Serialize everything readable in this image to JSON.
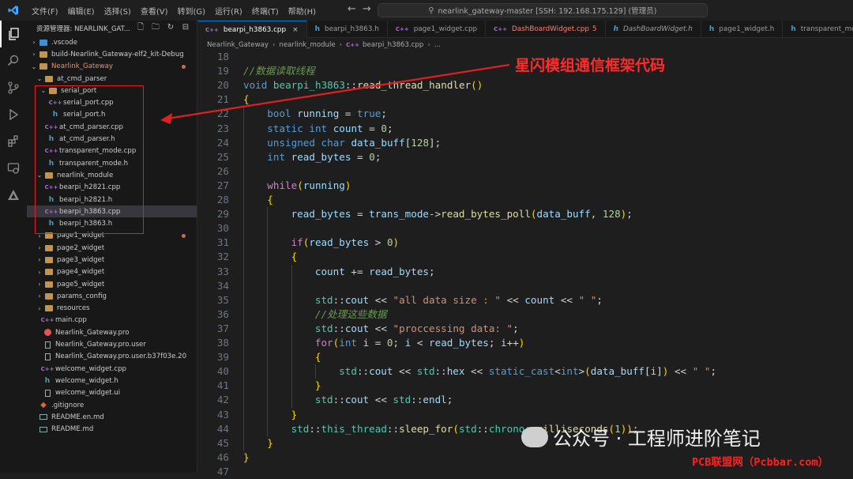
{
  "titlebar": {
    "menu": [
      "文件(F)",
      "编辑(E)",
      "选择(S)",
      "查看(V)",
      "转到(G)",
      "运行(R)",
      "终端(T)",
      "帮助(H)"
    ],
    "search": "nearlink_gateway-master [SSH: 192.168.175.129] (管理员)"
  },
  "sidebar": {
    "title": "资源管理器: NEARLINK_GAT...",
    "tree": [
      {
        "label": ".vscode",
        "depth": 1,
        "kind": "folder-blue",
        "chev": "›"
      },
      {
        "label": "build-Nearlink_Gateway-elf2_kit-Debug",
        "depth": 1,
        "kind": "folder",
        "chev": "›"
      },
      {
        "label": "Nearlink_Gateway",
        "depth": 1,
        "kind": "folder",
        "chev": "⌄",
        "accent": true,
        "dot": true
      },
      {
        "label": "at_cmd_parser",
        "depth": 2,
        "kind": "folder",
        "chev": "⌄"
      },
      {
        "label": "serial_port",
        "depth": 3,
        "kind": "folder",
        "chev": "⌄"
      },
      {
        "label": "serial_port.cpp",
        "depth": 4,
        "kind": "cpp"
      },
      {
        "label": "serial_port.h",
        "depth": 4,
        "kind": "h"
      },
      {
        "label": "at_cmd_parser.cpp",
        "depth": 3,
        "kind": "cpp"
      },
      {
        "label": "at_cmd_parser.h",
        "depth": 3,
        "kind": "h"
      },
      {
        "label": "transparent_mode.cpp",
        "depth": 3,
        "kind": "cpp"
      },
      {
        "label": "transparent_mode.h",
        "depth": 3,
        "kind": "h"
      },
      {
        "label": "nearlink_module",
        "depth": 2,
        "kind": "folder",
        "chev": "⌄"
      },
      {
        "label": "bearpi_h2821.cpp",
        "depth": 3,
        "kind": "cpp"
      },
      {
        "label": "bearpi_h2821.h",
        "depth": 3,
        "kind": "h"
      },
      {
        "label": "bearpi_h3863.cpp",
        "depth": 3,
        "kind": "cpp",
        "selected": true
      },
      {
        "label": "bearpi_h3863.h",
        "depth": 3,
        "kind": "h"
      },
      {
        "label": "page1_widget",
        "depth": 2,
        "kind": "folder",
        "chev": "›",
        "dot": true
      },
      {
        "label": "page2_widget",
        "depth": 2,
        "kind": "folder",
        "chev": "›"
      },
      {
        "label": "page3_widget",
        "depth": 2,
        "kind": "folder",
        "chev": "›"
      },
      {
        "label": "page4_widget",
        "depth": 2,
        "kind": "folder",
        "chev": "›"
      },
      {
        "label": "page5_widget",
        "depth": 2,
        "kind": "folder",
        "chev": "›"
      },
      {
        "label": "params_config",
        "depth": 2,
        "kind": "folder",
        "chev": "›"
      },
      {
        "label": "resources",
        "depth": 2,
        "kind": "folder",
        "chev": "›"
      },
      {
        "label": "main.cpp",
        "depth": 2,
        "kind": "cpp"
      },
      {
        "label": "Nearlink_Gateway.pro",
        "depth": 2,
        "kind": "pro"
      },
      {
        "label": "Nearlink_Gateway.pro.user",
        "depth": 2,
        "kind": "file"
      },
      {
        "label": "Nearlink_Gateway.pro.user.b37f03e.20",
        "depth": 2,
        "kind": "file"
      },
      {
        "label": "welcome_widget.cpp",
        "depth": 2,
        "kind": "cpp"
      },
      {
        "label": "welcome_widget.h",
        "depth": 2,
        "kind": "h"
      },
      {
        "label": "welcome_widget.ui",
        "depth": 2,
        "kind": "file"
      },
      {
        "label": ".gitignore",
        "depth": 1,
        "kind": "git"
      },
      {
        "label": "README.en.md",
        "depth": 1,
        "kind": "md"
      },
      {
        "label": "README.md",
        "depth": 1,
        "kind": "md"
      }
    ]
  },
  "tabs": [
    {
      "label": "bearpi_h3863.cpp",
      "kind": "cpp",
      "active": true
    },
    {
      "label": "bearpi_h3863.h",
      "kind": "h"
    },
    {
      "label": "page1_widget.cpp",
      "kind": "cpp"
    },
    {
      "label": "DashBoardWidget.cpp",
      "kind": "cpp",
      "badge": "5",
      "error": true
    },
    {
      "label": "DashBoardWidget.h",
      "kind": "h",
      "italic": true
    },
    {
      "label": "page1_widget.h",
      "kind": "h"
    },
    {
      "label": "transparent_mode.h",
      "kind": "h"
    }
  ],
  "breadcrumb": [
    "Nearlink_Gateway",
    "nearlink_module",
    "bearpi_h3863.cpp",
    "..."
  ],
  "code": [
    {
      "n": "18",
      "indent": 0,
      "parts": []
    },
    {
      "n": "19",
      "indent": 0,
      "parts": [
        [
          "cmt",
          "//数据读取线程"
        ]
      ]
    },
    {
      "n": "20",
      "indent": 0,
      "parts": [
        [
          "kw",
          "void "
        ],
        [
          "ty",
          "bearpi_h3863"
        ],
        [
          "op",
          "::"
        ],
        [
          "fn",
          "read_thread_handler"
        ],
        [
          "pun",
          "()"
        ]
      ]
    },
    {
      "n": "21",
      "indent": 0,
      "parts": [
        [
          "pun",
          "{"
        ]
      ]
    },
    {
      "n": "22",
      "indent": 1,
      "parts": [
        [
          "kw",
          "bool "
        ],
        [
          "var",
          "running"
        ],
        [
          "op",
          " = "
        ],
        [
          "kw",
          "true"
        ],
        [
          "op",
          ";"
        ]
      ]
    },
    {
      "n": "23",
      "indent": 1,
      "parts": [
        [
          "kw",
          "static int "
        ],
        [
          "var",
          "count"
        ],
        [
          "op",
          " = "
        ],
        [
          "num",
          "0"
        ],
        [
          "op",
          ";"
        ]
      ]
    },
    {
      "n": "24",
      "indent": 1,
      "parts": [
        [
          "kw",
          "unsigned char "
        ],
        [
          "var",
          "data_buff"
        ],
        [
          "op",
          "["
        ],
        [
          "num",
          "128"
        ],
        [
          "op",
          "];"
        ]
      ]
    },
    {
      "n": "25",
      "indent": 1,
      "parts": [
        [
          "kw",
          "int "
        ],
        [
          "var",
          "read_bytes"
        ],
        [
          "op",
          " = "
        ],
        [
          "num",
          "0"
        ],
        [
          "op",
          ";"
        ]
      ]
    },
    {
      "n": "26",
      "indent": 0,
      "parts": []
    },
    {
      "n": "27",
      "indent": 1,
      "parts": [
        [
          "ctl",
          "while"
        ],
        [
          "pun",
          "("
        ],
        [
          "var",
          "running"
        ],
        [
          "pun",
          ")"
        ]
      ]
    },
    {
      "n": "28",
      "indent": 1,
      "parts": [
        [
          "pun",
          "{"
        ]
      ]
    },
    {
      "n": "29",
      "indent": 2,
      "parts": [
        [
          "var",
          "read_bytes"
        ],
        [
          "op",
          " = "
        ],
        [
          "var",
          "trans_mode"
        ],
        [
          "op",
          "->"
        ],
        [
          "fn",
          "read_bytes_poll"
        ],
        [
          "pun",
          "("
        ],
        [
          "var",
          "data_buff"
        ],
        [
          "op",
          ", "
        ],
        [
          "num",
          "128"
        ],
        [
          "pun",
          ")"
        ],
        [
          "op",
          ";"
        ]
      ]
    },
    {
      "n": "30",
      "indent": 0,
      "parts": []
    },
    {
      "n": "31",
      "indent": 2,
      "parts": [
        [
          "ctl",
          "if"
        ],
        [
          "pun",
          "("
        ],
        [
          "var",
          "read_bytes"
        ],
        [
          "op",
          " > "
        ],
        [
          "num",
          "0"
        ],
        [
          "pun",
          ")"
        ]
      ]
    },
    {
      "n": "32",
      "indent": 2,
      "parts": [
        [
          "pun",
          "{"
        ]
      ]
    },
    {
      "n": "33",
      "indent": 3,
      "parts": [
        [
          "var",
          "count"
        ],
        [
          "op",
          " += "
        ],
        [
          "var",
          "read_bytes"
        ],
        [
          "op",
          ";"
        ]
      ]
    },
    {
      "n": "34",
      "indent": 0,
      "parts": []
    },
    {
      "n": "35",
      "indent": 3,
      "parts": [
        [
          "ty",
          "std"
        ],
        [
          "op",
          "::"
        ],
        [
          "var",
          "cout"
        ],
        [
          "op",
          " << "
        ],
        [
          "str",
          "\"all data size : \""
        ],
        [
          "op",
          " << "
        ],
        [
          "var",
          "count"
        ],
        [
          "op",
          " << "
        ],
        [
          "str",
          "\" \""
        ],
        [
          "op",
          ";"
        ]
      ]
    },
    {
      "n": "36",
      "indent": 3,
      "parts": [
        [
          "cmt",
          "//处理这些数据"
        ]
      ]
    },
    {
      "n": "37",
      "indent": 3,
      "parts": [
        [
          "ty",
          "std"
        ],
        [
          "op",
          "::"
        ],
        [
          "var",
          "cout"
        ],
        [
          "op",
          " << "
        ],
        [
          "str",
          "\"proccessing data: \""
        ],
        [
          "op",
          ";"
        ]
      ]
    },
    {
      "n": "38",
      "indent": 3,
      "parts": [
        [
          "ctl",
          "for"
        ],
        [
          "pun",
          "("
        ],
        [
          "kw",
          "int "
        ],
        [
          "var",
          "i"
        ],
        [
          "op",
          " = "
        ],
        [
          "num",
          "0"
        ],
        [
          "op",
          "; "
        ],
        [
          "var",
          "i"
        ],
        [
          "op",
          " < "
        ],
        [
          "var",
          "read_bytes"
        ],
        [
          "op",
          "; "
        ],
        [
          "var",
          "i"
        ],
        [
          "op",
          "++"
        ],
        [
          "pun",
          ")"
        ]
      ]
    },
    {
      "n": "39",
      "indent": 3,
      "parts": [
        [
          "pun",
          "{"
        ]
      ]
    },
    {
      "n": "40",
      "indent": 4,
      "parts": [
        [
          "ty",
          "std"
        ],
        [
          "op",
          "::"
        ],
        [
          "var",
          "cout"
        ],
        [
          "op",
          " << "
        ],
        [
          "ty",
          "std"
        ],
        [
          "op",
          "::"
        ],
        [
          "var",
          "hex"
        ],
        [
          "op",
          " << "
        ],
        [
          "kw",
          "static_cast"
        ],
        [
          "op",
          "<"
        ],
        [
          "kw",
          "int"
        ],
        [
          "op",
          ">"
        ],
        [
          "pun",
          "("
        ],
        [
          "var",
          "data_buff"
        ],
        [
          "op",
          "["
        ],
        [
          "var",
          "i"
        ],
        [
          "op",
          "]"
        ],
        [
          "pun",
          ")"
        ],
        [
          "op",
          " << "
        ],
        [
          "str",
          "\" \""
        ],
        [
          "op",
          ";"
        ]
      ]
    },
    {
      "n": "41",
      "indent": 3,
      "parts": [
        [
          "pun",
          "}"
        ]
      ]
    },
    {
      "n": "42",
      "indent": 3,
      "parts": [
        [
          "ty",
          "std"
        ],
        [
          "op",
          "::"
        ],
        [
          "var",
          "cout"
        ],
        [
          "op",
          " << "
        ],
        [
          "ty",
          "std"
        ],
        [
          "op",
          "::"
        ],
        [
          "var",
          "endl"
        ],
        [
          "op",
          ";"
        ]
      ]
    },
    {
      "n": "43",
      "indent": 2,
      "parts": [
        [
          "pun",
          "}"
        ]
      ]
    },
    {
      "n": "44",
      "indent": 2,
      "parts": [
        [
          "ty",
          "std"
        ],
        [
          "op",
          "::"
        ],
        [
          "ty",
          "this_thread"
        ],
        [
          "op",
          "::"
        ],
        [
          "fn",
          "sleep_for"
        ],
        [
          "pun",
          "("
        ],
        [
          "ty",
          "std"
        ],
        [
          "op",
          "::"
        ],
        [
          "ty",
          "chrono"
        ],
        [
          "op",
          "::"
        ],
        [
          "fn",
          "milliseconds"
        ],
        [
          "pun",
          "("
        ],
        [
          "num",
          "1"
        ],
        [
          "pun",
          "))"
        ],
        [
          "op",
          ";"
        ]
      ]
    },
    {
      "n": "45",
      "indent": 1,
      "parts": [
        [
          "pun",
          "}"
        ]
      ]
    },
    {
      "n": "46",
      "indent": 0,
      "parts": [
        [
          "pun",
          "}"
        ]
      ]
    },
    {
      "n": "47",
      "indent": 0,
      "parts": []
    }
  ],
  "annotation": {
    "text": "星闪模组通信框架代码",
    "color": "#ff2a2a"
  },
  "watermark": {
    "text": "公众号 · 工程师进阶笔记",
    "source": "PCB联盟网（Pcbbar.com）"
  },
  "colors": {
    "accent": "#0078d4",
    "error": "#f88070",
    "annotation": "#e02020"
  }
}
